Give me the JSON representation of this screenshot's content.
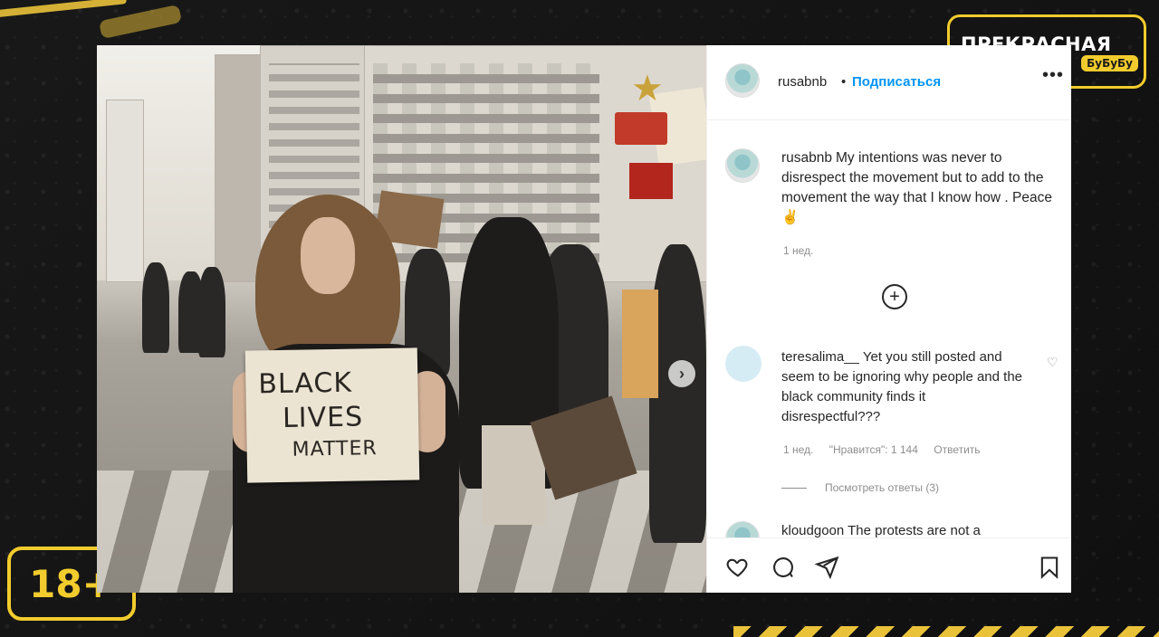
{
  "brand": {
    "title": "ПРЕКРАСНАЯ",
    "subtitle": "БуБуБу",
    "accent_color": "#f2cc2d"
  },
  "age_badge": "18+",
  "post": {
    "image": {
      "sign_lines": [
        "BLACK",
        "LIVES",
        "MATTER"
      ],
      "next_icon": "chevron-right-icon"
    },
    "header": {
      "username": "rusabnb",
      "separator": "•",
      "follow_label": "Подписаться",
      "more_icon": "•••"
    },
    "caption": {
      "username": "rusabnb",
      "text": "My intentions was never to disrespect the movement but to add to the movement the way that I know how . Peace ✌",
      "time": "1 нед."
    },
    "load_more_icon": "⊕",
    "comments": [
      {
        "username": "teresalima__",
        "text": "Yet you still posted and seem to be ignoring why people and the black community finds it disrespectful???",
        "time": "1 нед.",
        "likes": "\"Нравится\": 1 144",
        "reply_label": "Ответить",
        "view_replies": "Посмотреть ответы (3)"
      }
    ],
    "partial_comment": {
      "username": "kloudgoon",
      "text": "The protests are not a"
    },
    "actions": [
      "heart-icon",
      "comment-icon",
      "share-icon",
      "bookmark-icon"
    ]
  }
}
